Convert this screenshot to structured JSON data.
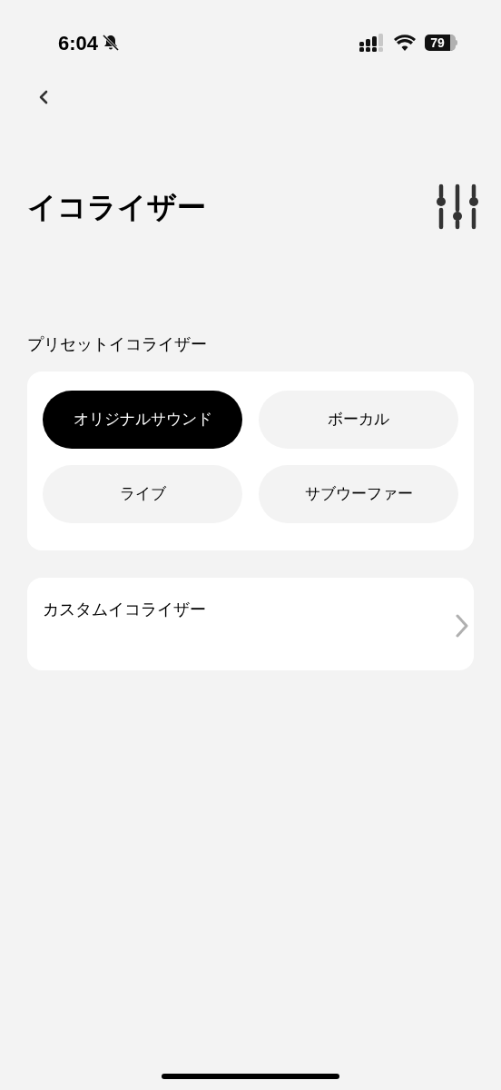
{
  "status_bar": {
    "time": "6:04",
    "battery": "79"
  },
  "title": "イコライザー",
  "preset_section": {
    "label": "プリセットイコライザー",
    "presets": [
      {
        "label": "オリジナルサウンド",
        "selected": true
      },
      {
        "label": "ボーカル",
        "selected": false
      },
      {
        "label": "ライブ",
        "selected": false
      },
      {
        "label": "サブウーファー",
        "selected": false
      }
    ]
  },
  "custom_row": {
    "label": "カスタムイコライザー"
  }
}
